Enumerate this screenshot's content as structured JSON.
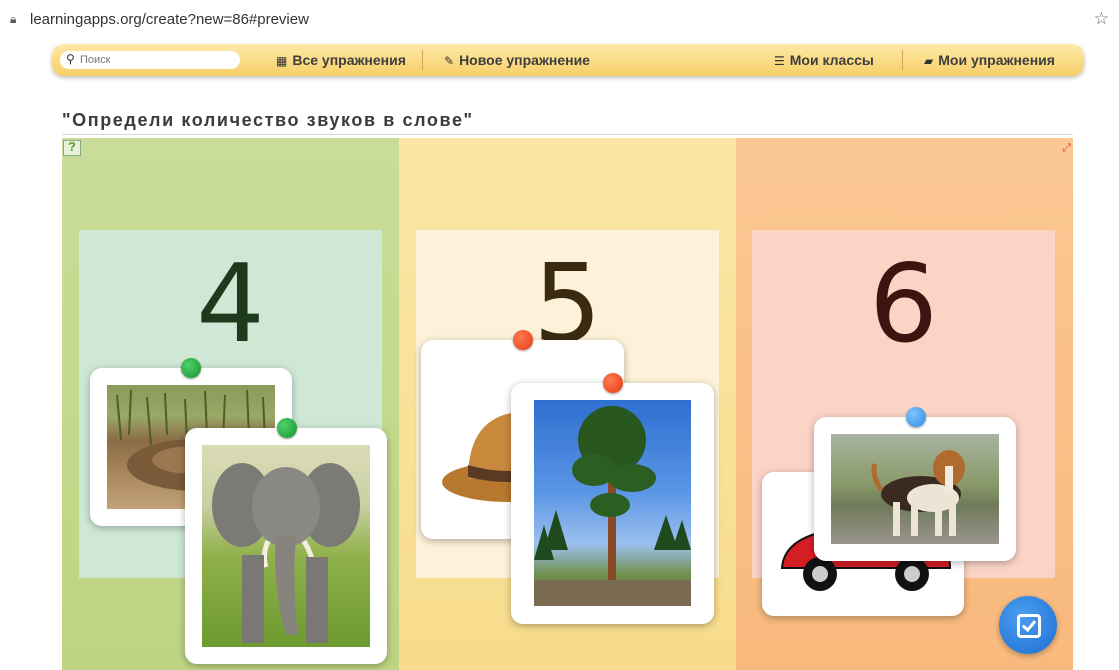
{
  "browser": {
    "url": "learningapps.org/create?new=86#preview"
  },
  "nav": {
    "search_placeholder": "Поиск",
    "all_exercises": "Все упражнения",
    "new_exercise": "Новое упражнение",
    "my_classes": "Мои классы",
    "my_exercises": "Мои упражнения"
  },
  "exercise": {
    "title": "\"Определи количество звуков в слове\"",
    "columns": [
      {
        "number": "4",
        "color": "#c9dd98"
      },
      {
        "number": "5",
        "color": "#fbe6a5"
      },
      {
        "number": "6",
        "color": "#fbc894"
      }
    ],
    "cards": [
      {
        "subject": "earth-mound",
        "pin_color": "green"
      },
      {
        "subject": "elephant",
        "pin_color": "green"
      },
      {
        "subject": "hat",
        "pin_color": "red"
      },
      {
        "subject": "pine-tree",
        "pin_color": "red"
      },
      {
        "subject": "car",
        "pin_color": "none"
      },
      {
        "subject": "beagle-dog",
        "pin_color": "blue"
      }
    ]
  },
  "icons": [
    "lock-icon",
    "star-icon",
    "search-icon",
    "grid-icon",
    "pencil-icon",
    "list-icon",
    "folder-icon",
    "help-icon",
    "fullscreen-icon",
    "check-icon"
  ]
}
